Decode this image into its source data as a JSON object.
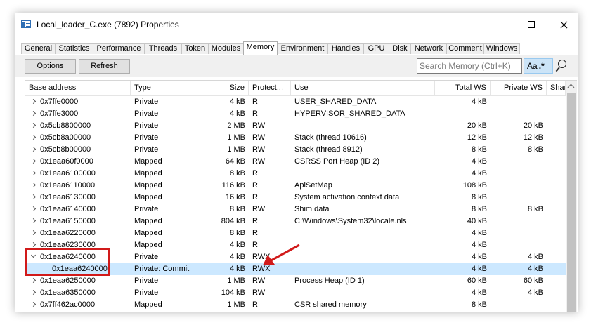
{
  "window": {
    "title": "Local_loader_C.exe (7892) Properties"
  },
  "tabs": [
    {
      "label": "General"
    },
    {
      "label": "Statistics"
    },
    {
      "label": "Performance"
    },
    {
      "label": "Threads"
    },
    {
      "label": "Token"
    },
    {
      "label": "Modules"
    },
    {
      "label": "Memory",
      "active": true
    },
    {
      "label": "Environment"
    },
    {
      "label": "Handles"
    },
    {
      "label": "GPU"
    },
    {
      "label": "Disk"
    },
    {
      "label": "Network"
    },
    {
      "label": "Comment"
    },
    {
      "label": "Windows"
    }
  ],
  "toolbar": {
    "options_label": "Options",
    "refresh_label": "Refresh",
    "search_placeholder": "Search Memory (Ctrl+K)",
    "regex_label": "Aa",
    "regex_star": ".*"
  },
  "columns": [
    "Base address",
    "Type",
    "Size",
    "Protect...",
    "Use",
    "Total WS",
    "Private WS",
    "Share"
  ],
  "rows": [
    {
      "addr": "0x7ffe0000",
      "type": "Private",
      "size": "4 kB",
      "prot": "R",
      "use": "USER_SHARED_DATA",
      "total_ws": "4 kB",
      "private_ws": "",
      "expander": "collapsed"
    },
    {
      "addr": "0x7ffe3000",
      "type": "Private",
      "size": "4 kB",
      "prot": "R",
      "use": "HYPERVISOR_SHARED_DATA",
      "total_ws": "",
      "private_ws": "",
      "expander": "collapsed"
    },
    {
      "addr": "0x5cb8800000",
      "type": "Private",
      "size": "2 MB",
      "prot": "RW",
      "use": "",
      "total_ws": "20 kB",
      "private_ws": "20 kB",
      "expander": "collapsed"
    },
    {
      "addr": "0x5cb8a00000",
      "type": "Private",
      "size": "1 MB",
      "prot": "RW",
      "use": "Stack (thread 10616)",
      "total_ws": "12 kB",
      "private_ws": "12 kB",
      "expander": "collapsed"
    },
    {
      "addr": "0x5cb8b00000",
      "type": "Private",
      "size": "1 MB",
      "prot": "RW",
      "use": "Stack (thread 8912)",
      "total_ws": "8 kB",
      "private_ws": "8 kB",
      "expander": "collapsed"
    },
    {
      "addr": "0x1eaa60f0000",
      "type": "Mapped",
      "size": "64 kB",
      "prot": "RW",
      "use": "CSRSS Port Heap (ID 2)",
      "total_ws": "4 kB",
      "private_ws": "",
      "expander": "collapsed"
    },
    {
      "addr": "0x1eaa6100000",
      "type": "Mapped",
      "size": "8 kB",
      "prot": "R",
      "use": "",
      "total_ws": "4 kB",
      "private_ws": "",
      "expander": "collapsed"
    },
    {
      "addr": "0x1eaa6110000",
      "type": "Mapped",
      "size": "116 kB",
      "prot": "R",
      "use": "ApiSetMap",
      "total_ws": "108 kB",
      "private_ws": "",
      "expander": "collapsed"
    },
    {
      "addr": "0x1eaa6130000",
      "type": "Mapped",
      "size": "16 kB",
      "prot": "R",
      "use": "System activation context data",
      "total_ws": "8 kB",
      "private_ws": "",
      "expander": "collapsed"
    },
    {
      "addr": "0x1eaa6140000",
      "type": "Private",
      "size": "8 kB",
      "prot": "RW",
      "use": "Shim data",
      "total_ws": "8 kB",
      "private_ws": "8 kB",
      "expander": "collapsed"
    },
    {
      "addr": "0x1eaa6150000",
      "type": "Mapped",
      "size": "804 kB",
      "prot": "R",
      "use": "C:\\Windows\\System32\\locale.nls",
      "total_ws": "40 kB",
      "private_ws": "",
      "expander": "collapsed"
    },
    {
      "addr": "0x1eaa6220000",
      "type": "Mapped",
      "size": "8 kB",
      "prot": "R",
      "use": "",
      "total_ws": "4 kB",
      "private_ws": "",
      "expander": "collapsed"
    },
    {
      "addr": "0x1eaa6230000",
      "type": "Mapped",
      "size": "4 kB",
      "prot": "R",
      "use": "",
      "total_ws": "4 kB",
      "private_ws": "",
      "expander": "collapsed"
    },
    {
      "addr": "0x1eaa6240000",
      "type": "Private",
      "size": "4 kB",
      "prot": "RWX",
      "use": "",
      "total_ws": "4 kB",
      "private_ws": "4 kB",
      "expander": "expanded"
    },
    {
      "addr": "0x1eaa6240000",
      "type": "Private: Commit",
      "size": "4 kB",
      "prot": "RWX",
      "use": "",
      "total_ws": "4 kB",
      "private_ws": "4 kB",
      "expander": "none",
      "child": true,
      "selected": true
    },
    {
      "addr": "0x1eaa6250000",
      "type": "Private",
      "size": "1 MB",
      "prot": "RW",
      "use": "Process Heap (ID 1)",
      "total_ws": "60 kB",
      "private_ws": "60 kB",
      "expander": "collapsed"
    },
    {
      "addr": "0x1eaa6350000",
      "type": "Private",
      "size": "104 kB",
      "prot": "RW",
      "use": "",
      "total_ws": "4 kB",
      "private_ws": "4 kB",
      "expander": "collapsed"
    },
    {
      "addr": "0x7ff462ac0000",
      "type": "Mapped",
      "size": "1 MB",
      "prot": "R",
      "use": "CSR shared memory",
      "total_ws": "8 kB",
      "private_ws": "",
      "expander": "collapsed"
    }
  ],
  "colors": {
    "selection": "#cce8ff",
    "annotation": "#d11a1a",
    "regex_toggle": "#cce4f7"
  }
}
